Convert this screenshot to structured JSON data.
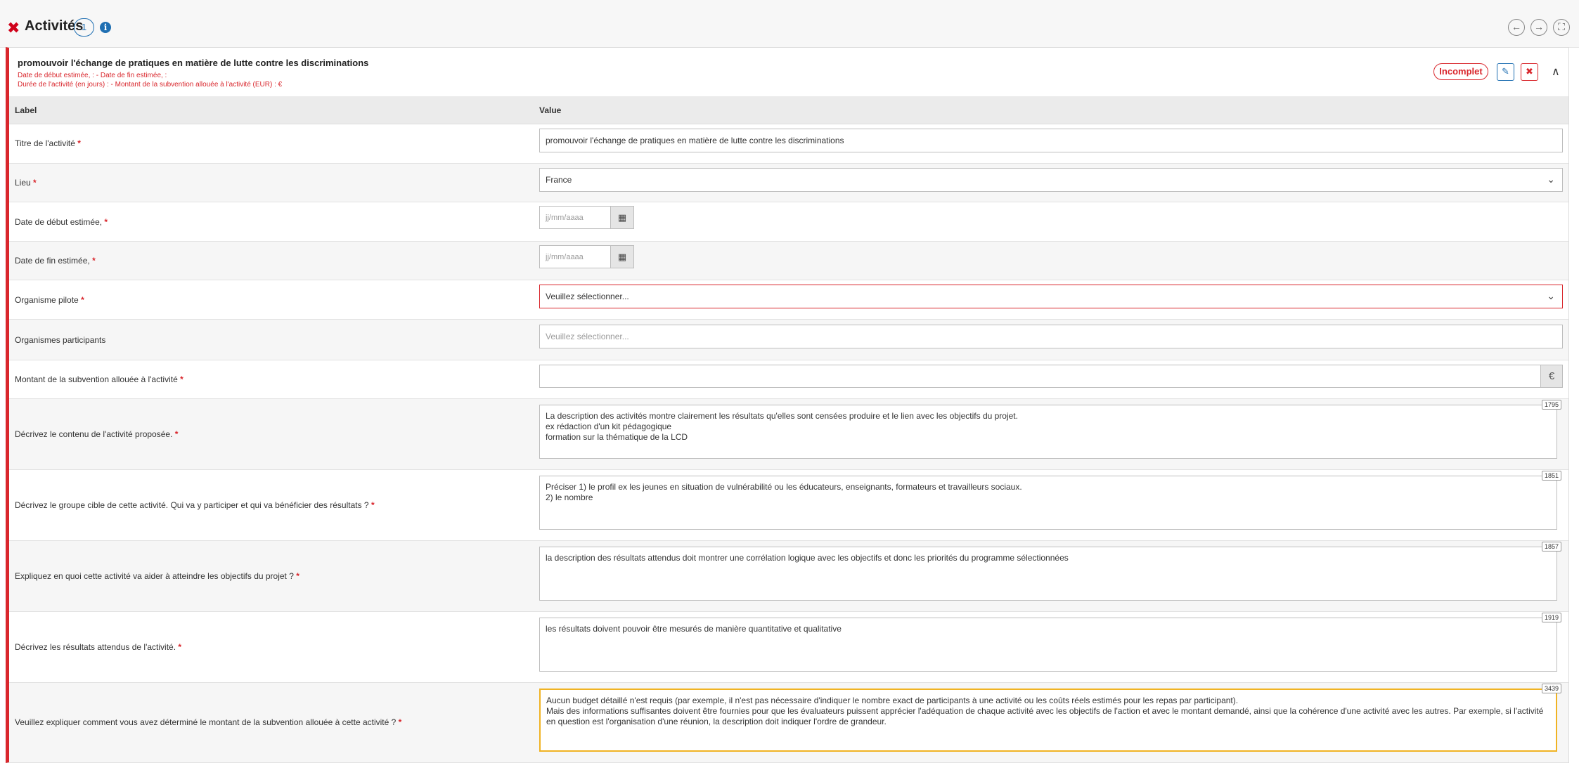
{
  "header": {
    "close_glyph": "✖",
    "title": "Activités",
    "count": "1",
    "info_glyph": "i",
    "nav_prev_glyph": "←",
    "nav_next_glyph": "→",
    "expand_glyph": "⛶"
  },
  "activity": {
    "title": "promouvoir l'échange de pratiques en matière de lutte contre les discriminations",
    "summary_line1": "Date de début estimée, :  - Date de fin estimée, :",
    "summary_line2": "Durée de l'activité (en jours) :  - Montant de la subvention allouée à l'activité (EUR) : €",
    "status": "Incomplet",
    "edit_glyph": "✎",
    "delete_glyph": "✖",
    "collapse_glyph": "∧"
  },
  "table": {
    "col_label": "Label",
    "col_value": "Value"
  },
  "fields": {
    "titre": {
      "label": "Titre de l'activité",
      "value": "promouvoir l'échange de pratiques en matière de lutte contre les discriminations"
    },
    "lieu": {
      "label": "Lieu",
      "value": "France",
      "chevron": "⌄"
    },
    "date_debut": {
      "label": "Date de début estimée,",
      "placeholder": "jj/mm/aaaa",
      "cal_glyph": "▦"
    },
    "date_fin": {
      "label": "Date de fin estimée,",
      "placeholder": "jj/mm/aaaa",
      "cal_glyph": "▦"
    },
    "organisme_pilote": {
      "label": "Organisme pilote",
      "value": "Veuillez sélectionner...",
      "chevron": "⌄"
    },
    "organismes_participants": {
      "label": "Organismes participants",
      "placeholder": "Veuillez sélectionner..."
    },
    "montant": {
      "label": "Montant de la subvention allouée à l'activité",
      "currency": "€"
    },
    "contenu": {
      "label": "Décrivez le contenu de l'activité proposée.",
      "counter": "1795",
      "value": "La description des activités montre clairement les résultats qu'elles sont censées produire et le lien avec les objectifs du projet.\nex rédaction d'un kit pédagogique\nformation sur la thématique de la LCD"
    },
    "groupe_cible": {
      "label": "Décrivez le groupe cible de cette activité. Qui va y participer et qui va bénéficier des résultats ?",
      "counter": "1851",
      "value": "Préciser 1) le profil ex les jeunes en situation de vulnérabilité ou les éducateurs, enseignants, formateurs et travailleurs sociaux.\n2) le nombre"
    },
    "objectifs": {
      "label": "Expliquez en quoi cette activité va aider à atteindre les objectifs du projet ?",
      "counter": "1857",
      "value": "la description des résultats attendus doit montrer une corrélation logique avec les objectifs et donc les priorités du programme sélectionnées"
    },
    "resultats": {
      "label": "Décrivez les résultats attendus de l'activité.",
      "counter": "1919",
      "value": "les résultats doivent pouvoir être mesurés de manière quantitative et qualitative"
    },
    "montant_explication": {
      "label": "Veuillez expliquer comment vous avez déterminé le montant de la subvention allouée à cette activité ?",
      "counter": "3439",
      "value": "Aucun budget détaillé n'est requis (par exemple, il n'est pas nécessaire d'indiquer le nombre exact de participants à une activité ou les coûts réels estimés pour les repas par participant).\nMais des informations suffisantes doivent être fournies pour que les évaluateurs puissent apprécier l'adéquation de chaque activité avec les objectifs de l'action et avec le montant demandé, ainsi que la cohérence d'une activité avec les autres. Par exemple, si l'activité en question est l'organisation d'une réunion, la description doit indiquer l'ordre de grandeur."
    }
  },
  "required_mark": "*"
}
